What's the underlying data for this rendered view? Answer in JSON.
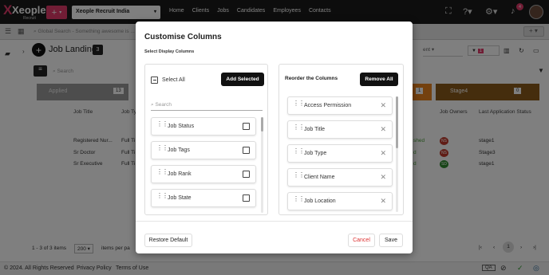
{
  "app": {
    "brand": "Xeople",
    "brand_sub": "Recruit",
    "org": "Xeople Recruit India",
    "nav": [
      "Home",
      "Clients",
      "Jobs",
      "Candidates",
      "Employees",
      "Contacts"
    ],
    "notif_count": "4"
  },
  "searchbar": {
    "placeholder": "Global Search - Something awesome is ..."
  },
  "page": {
    "title": "Job Landing",
    "count": "3",
    "search_placeholder": "Search",
    "stages": [
      {
        "label": "Applied",
        "count": "13"
      },
      {
        "label": "1",
        "count": ""
      },
      {
        "label": "Stage4",
        "count": "0"
      }
    ],
    "filter_count": "1",
    "columns": [
      "Job Title",
      "Job Ty",
      "Job Owners",
      "Last Application Status"
    ],
    "rows": [
      {
        "title": "Registered Nur...",
        "type": "Full Ti",
        "owner": "NS",
        "status": "stage1",
        "tag": "shed"
      },
      {
        "title": "Sr Doctor",
        "type": "Full Ti",
        "owner": "NS",
        "status": "Stage3",
        "tag": "d"
      },
      {
        "title": "Sr Executive",
        "type": "Full Ti",
        "owner": "SD",
        "status": "stage1",
        "tag": "d"
      }
    ],
    "pagination_text": "1 - 3 of 3 items",
    "page_size": "200",
    "per_page_label": "items per pa",
    "current_page": "1"
  },
  "footer": {
    "copyright": "© 2024. All Rights Reserved",
    "privacy": "Privacy Policy",
    "terms": "Terms of Use",
    "qa_badge": "QA"
  },
  "modal": {
    "title": "Customise Columns",
    "subtitle": "Select Display Columns",
    "select_all": "Select All",
    "add_selected": "Add Selected",
    "search_placeholder": "Search",
    "available": [
      "Job Status",
      "Job Tags",
      "Job Rank",
      "Job State"
    ],
    "reorder_title": "Reorder the Columns",
    "remove_all": "Remove All",
    "selected": [
      "Access Permission",
      "Job Title",
      "Job Type",
      "Client Name",
      "Job Location"
    ],
    "restore_default": "Restore Default",
    "cancel": "Cancel",
    "save": "Save"
  },
  "colors": {
    "accent": "#e23b6a",
    "dark": "#111111",
    "stage_orange": "#e8821e",
    "stage_gray": "#9a9a9a"
  }
}
